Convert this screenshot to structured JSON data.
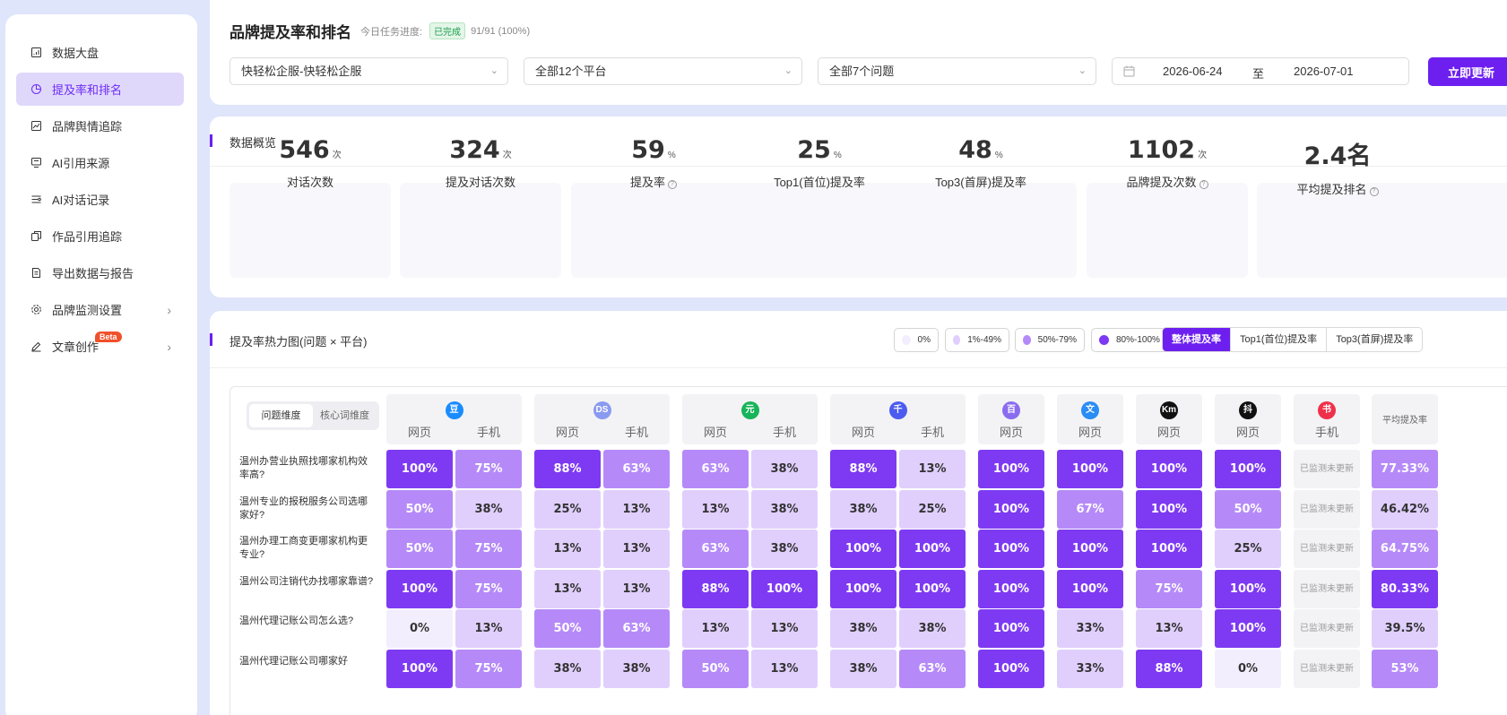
{
  "sidebar": {
    "items": [
      {
        "label": "数据大盘",
        "icon": "dashboard-icon",
        "active": false
      },
      {
        "label": "提及率和排名",
        "icon": "pie-chart-icon",
        "active": true
      },
      {
        "label": "品牌舆情追踪",
        "icon": "trend-chart-icon",
        "active": false
      },
      {
        "label": "AI引用来源",
        "icon": "monitor-icon",
        "active": false
      },
      {
        "label": "AI对话记录",
        "icon": "chat-list-icon",
        "active": false
      },
      {
        "label": "作品引用追踪",
        "icon": "copy-icon",
        "active": false
      },
      {
        "label": "导出数据与报告",
        "icon": "document-icon",
        "active": false
      },
      {
        "label": "品牌监测设置",
        "icon": "settings-icon",
        "active": false,
        "chevron": "›"
      },
      {
        "label": "文章创作",
        "icon": "edit-icon",
        "active": false,
        "chevron": "›",
        "badge": "Beta"
      }
    ]
  },
  "header": {
    "title": "品牌提及率和排名",
    "progress_label": "今日任务进度:",
    "status_badge": "已完成",
    "progress_value": "91/91 (100%)"
  },
  "filters": {
    "brand": "快轻松企服-快轻松企服",
    "platforms": "全部12个平台",
    "questions": "全部7个问题",
    "date_start": "2026-06-24",
    "date_sep": "至",
    "date_end": "2026-07-01",
    "refresh_label": "立即更新"
  },
  "overview": {
    "title": "数据概览",
    "stats": [
      {
        "value": "546",
        "unit": "次",
        "label": "对话次数",
        "help": false
      },
      {
        "value": "324",
        "unit": "次",
        "label": "提及对话次数",
        "help": false
      },
      {
        "value": "59",
        "unit": "%",
        "label": "提及率",
        "help": true
      },
      {
        "value": "25",
        "unit": "%",
        "label": "Top1(首位)提及率",
        "help": false
      },
      {
        "value": "48",
        "unit": "%",
        "label": "Top3(首屏)提及率",
        "help": false
      },
      {
        "value": "1102",
        "unit": "次",
        "label": "品牌提及次数",
        "help": true
      },
      {
        "value": "2.4名",
        "unit": "",
        "label": "平均提及排名",
        "help": true
      }
    ]
  },
  "heatmap": {
    "title": "提及率热力图(问题 × 平台)",
    "legend": [
      {
        "label": "0%",
        "color": "#f3eefe"
      },
      {
        "label": "1%-49%",
        "color": "#e0cffd"
      },
      {
        "label": "50%-79%",
        "color": "#b58af8"
      },
      {
        "label": "80%-100%",
        "color": "#7e3af2"
      }
    ],
    "metric_tabs": [
      "整体提及率",
      "Top1(首位)提及率",
      "Top3(首屏)提及率"
    ],
    "active_metric": 0,
    "dimension_tabs": [
      "问题维度",
      "核心词维度"
    ],
    "active_dimension": 0,
    "platforms": [
      {
        "icon": "豆",
        "color": "#1a8cff",
        "subs": [
          "网页",
          "手机"
        ]
      },
      {
        "icon": "DS",
        "color": "#8a9af0",
        "subs": [
          "网页",
          "手机"
        ]
      },
      {
        "icon": "元",
        "color": "#17b45a",
        "subs": [
          "网页",
          "手机"
        ]
      },
      {
        "icon": "千",
        "color": "#4d5cf0",
        "subs": [
          "网页",
          "手机"
        ]
      },
      {
        "icon": "百",
        "color": "#8a6cf0",
        "subs": [
          "网页"
        ]
      },
      {
        "icon": "文",
        "color": "#2a8cf5",
        "subs": [
          "网页"
        ]
      },
      {
        "icon": "Km",
        "color": "#111111",
        "subs": [
          "网页"
        ]
      },
      {
        "icon": "抖",
        "color": "#111111",
        "subs": [
          "网页"
        ]
      },
      {
        "icon": "书",
        "color": "#f0304a",
        "subs": [
          "手机"
        ]
      }
    ],
    "avg_header": "平均提及率",
    "na_text": "已监测未更新",
    "rows": [
      {
        "question": "温州办营业执照找哪家机构效率高?",
        "values": [
          "100%",
          "75%",
          "88%",
          "63%",
          "63%",
          "38%",
          "88%",
          "13%",
          "100%",
          "100%",
          "100%",
          "100%"
        ],
        "avg": "77.33%"
      },
      {
        "question": "温州专业的报税服务公司选哪家好?",
        "values": [
          "50%",
          "38%",
          "25%",
          "13%",
          "13%",
          "38%",
          "38%",
          "25%",
          "100%",
          "67%",
          "100%",
          "50%"
        ],
        "avg": "46.42%"
      },
      {
        "question": "温州办理工商变更哪家机构更专业?",
        "values": [
          "50%",
          "75%",
          "13%",
          "13%",
          "63%",
          "38%",
          "100%",
          "100%",
          "100%",
          "100%",
          "100%",
          "25%"
        ],
        "avg": "64.75%"
      },
      {
        "question": "温州公司注销代办找哪家靠谱?",
        "values": [
          "100%",
          "75%",
          "13%",
          "13%",
          "88%",
          "100%",
          "100%",
          "100%",
          "100%",
          "100%",
          "75%",
          "100%"
        ],
        "avg": "80.33%"
      },
      {
        "question": "温州代理记账公司怎么选?",
        "values": [
          "0%",
          "13%",
          "50%",
          "63%",
          "13%",
          "13%",
          "38%",
          "38%",
          "100%",
          "33%",
          "13%",
          "100%"
        ],
        "avg": "39.5%"
      },
      {
        "question": "温州代理记账公司哪家好",
        "values": [
          "100%",
          "75%",
          "38%",
          "38%",
          "50%",
          "13%",
          "38%",
          "63%",
          "100%",
          "33%",
          "88%",
          "0%"
        ],
        "avg": "53%"
      }
    ]
  }
}
